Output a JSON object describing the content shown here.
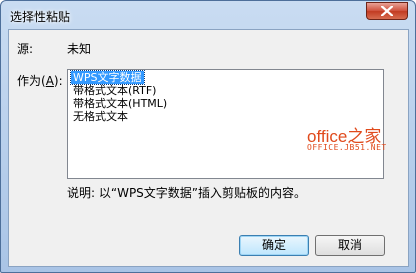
{
  "window": {
    "title": "选择性粘贴"
  },
  "source": {
    "label": "源:",
    "value": "未知"
  },
  "paste_as": {
    "label_prefix": "作为(",
    "label_key": "A",
    "label_suffix": "):",
    "options": [
      {
        "label": "WPS文字数据",
        "selected": true
      },
      {
        "label": "带格式文本(RTF)",
        "selected": false
      },
      {
        "label": "带格式文本(HTML)",
        "selected": false
      },
      {
        "label": "无格式文本",
        "selected": false
      }
    ]
  },
  "watermark": {
    "main": "office之家",
    "sub": "OFFICE.JB51.NET"
  },
  "description": "说明: 以“WPS文字数据”插入剪贴板的内容。",
  "buttons": {
    "ok": "确定",
    "cancel": "取消"
  },
  "colors": {
    "selection": "#3399ff",
    "watermark": "#e04a1c",
    "close_button": "#c23b22"
  },
  "icons": {
    "close": "close-icon"
  }
}
